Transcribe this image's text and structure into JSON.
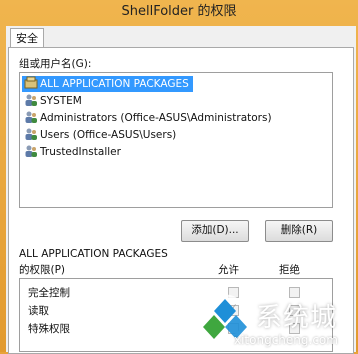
{
  "window": {
    "title": "ShellFolder 的权限"
  },
  "tabs": [
    {
      "label": "安全"
    }
  ],
  "groups": {
    "label": "组或用户名(G):",
    "items": [
      {
        "label": "ALL APPLICATION PACKAGES",
        "icon": "package-group-icon",
        "selected": true
      },
      {
        "label": "SYSTEM",
        "icon": "users-icon",
        "selected": false
      },
      {
        "label": "Administrators (Office-ASUS\\Administrators)",
        "icon": "users-icon",
        "selected": false
      },
      {
        "label": "Users (Office-ASUS\\Users)",
        "icon": "users-icon",
        "selected": false
      },
      {
        "label": "TrustedInstaller",
        "icon": "users-icon",
        "selected": false
      }
    ]
  },
  "buttons": {
    "add": "添加(D)...",
    "remove": "删除(R)"
  },
  "permissions": {
    "principal": "ALL APPLICATION PACKAGES",
    "title": "的权限(P)",
    "allow_header": "允许",
    "deny_header": "拒绝",
    "rows": [
      {
        "name": "完全控制",
        "allow": false,
        "deny": false
      },
      {
        "name": "读取",
        "allow": true,
        "deny": false
      },
      {
        "name": "特殊权限",
        "allow": false,
        "deny": false
      }
    ]
  },
  "watermark": {
    "text": "系统城",
    "url": "xitongcheng.com"
  },
  "colors": {
    "titlebar": "#e8a33a",
    "selection": "#3399ff"
  }
}
